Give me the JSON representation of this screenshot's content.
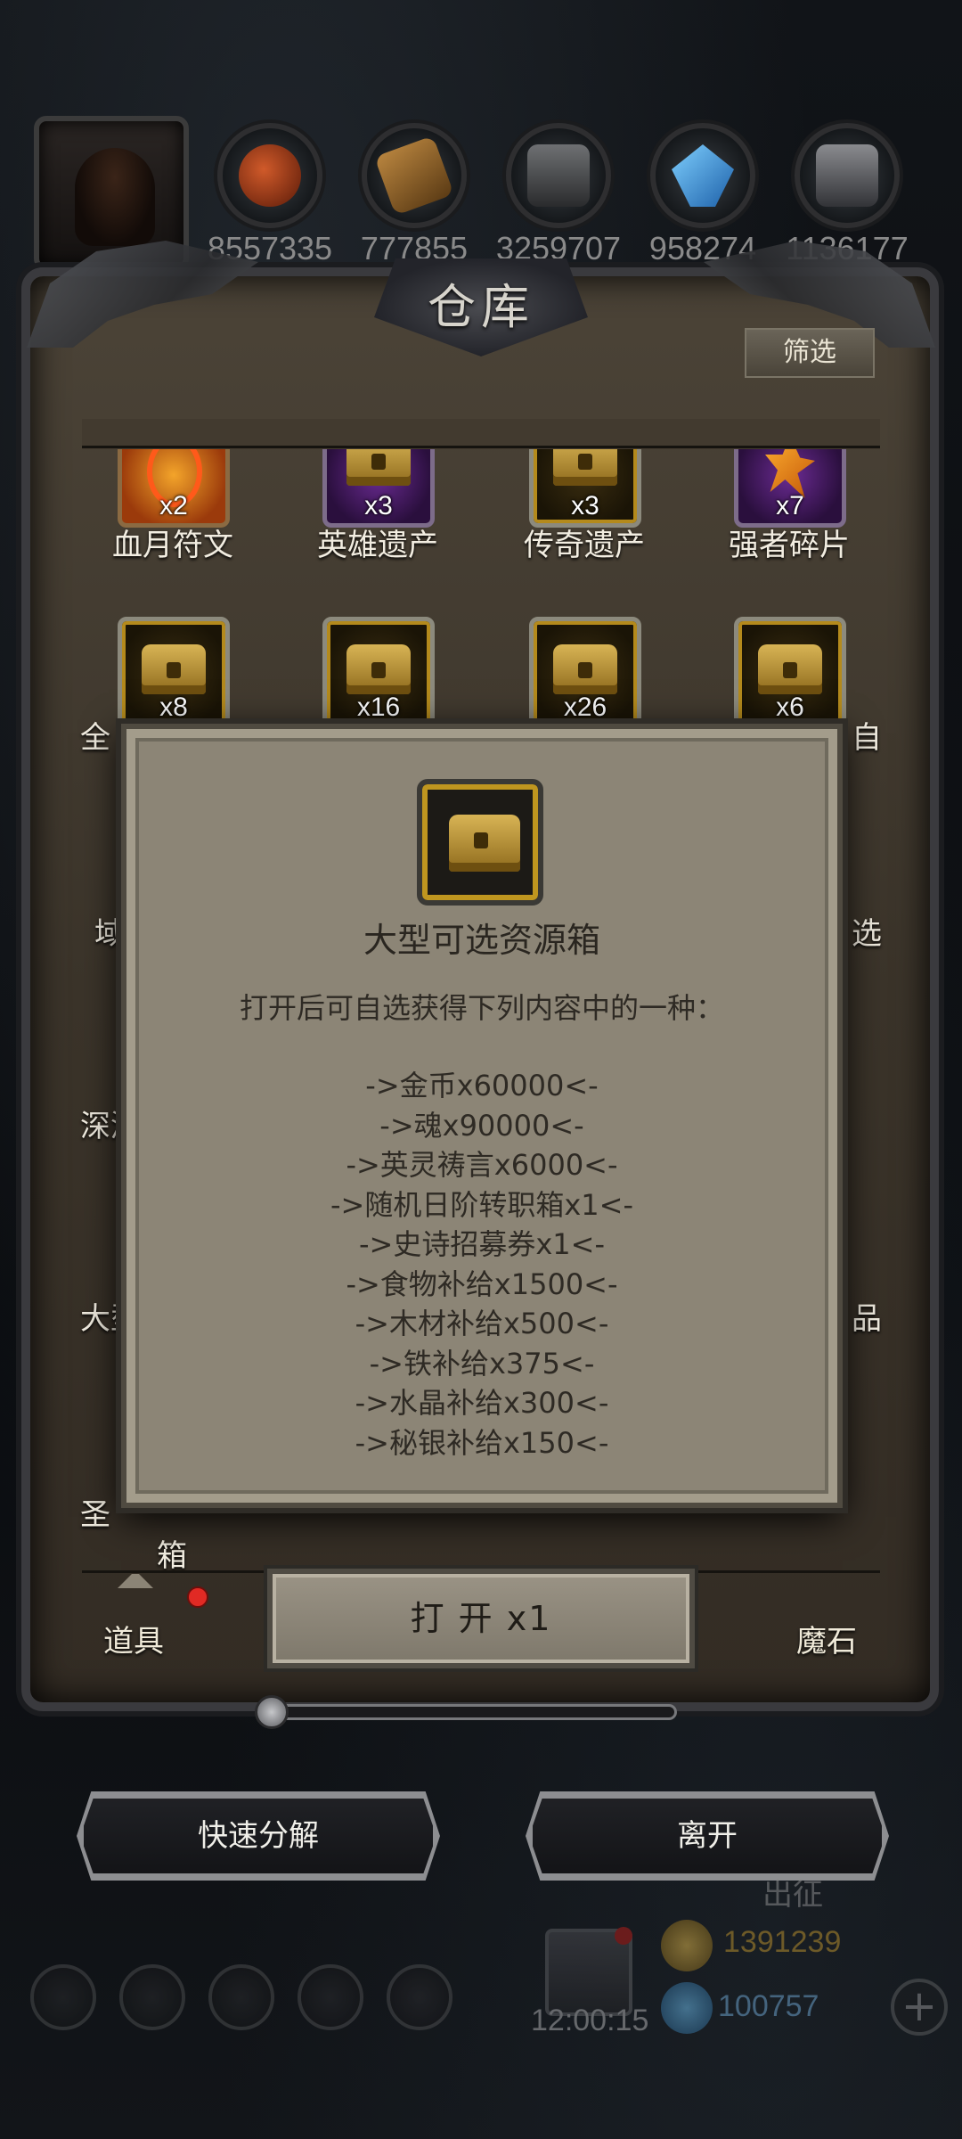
{
  "resources": [
    {
      "icon": "meat-icon",
      "value": "8557335"
    },
    {
      "icon": "wood-icon",
      "value": "777855"
    },
    {
      "icon": "iron-icon",
      "value": "3259707"
    },
    {
      "icon": "crystal-icon",
      "value": "958274"
    },
    {
      "icon": "mithril-icon",
      "value": "1136177"
    }
  ],
  "panel": {
    "title": "仓库",
    "filter_label": "筛选"
  },
  "items_row1": [
    {
      "name": "血月符文",
      "count": "x2",
      "icon": "rune-icon"
    },
    {
      "name": "英雄遗产",
      "count": "x3",
      "icon": "chest-icon"
    },
    {
      "name": "传奇遗产",
      "count": "x3",
      "icon": "chest-icon"
    },
    {
      "name": "强者碎片",
      "count": "x7",
      "icon": "shard-icon"
    }
  ],
  "items_row2": [
    {
      "count": "x8",
      "icon": "chest-icon"
    },
    {
      "count": "x16",
      "icon": "chest-icon"
    },
    {
      "count": "x26",
      "icon": "chest-icon"
    },
    {
      "count": "x6",
      "icon": "chest-icon"
    }
  ],
  "side_labels_left": [
    "全",
    "域",
    "深渊",
    "大型",
    "圣"
  ],
  "side_labels_right": [
    "自",
    "选",
    "品"
  ],
  "partial_bottom_label": "箱",
  "dialog": {
    "title": "大型可选资源箱",
    "description": "打开后可自选获得下列内容中的一种：",
    "options": [
      "->金币x60000<-",
      "->魂x90000<-",
      "->英灵祷言x6000<-",
      "->随机日阶转职箱x1<-",
      "->史诗招募券x1<-",
      "->食物补给x1500<-",
      "->木材补给x500<-",
      "->铁补给x375<-",
      "->水晶补给x300<-",
      "->秘银补给x150<-"
    ]
  },
  "open_button_label": "打 开 x1",
  "tabs": {
    "items": "道具",
    "magic_stone": "魔石"
  },
  "buttons": {
    "quick_decompose": "快速分解",
    "leave": "离开"
  },
  "hud": {
    "expedition": "出征",
    "timer": "12:00:15",
    "gold": "1391239",
    "crystal": "100757",
    "plus": "+"
  },
  "colors": {
    "dialog_bg": "#8c8576",
    "panel_bg": "#3b342a",
    "gold_frame": "#b48a1c",
    "notification": "#e12a24"
  }
}
